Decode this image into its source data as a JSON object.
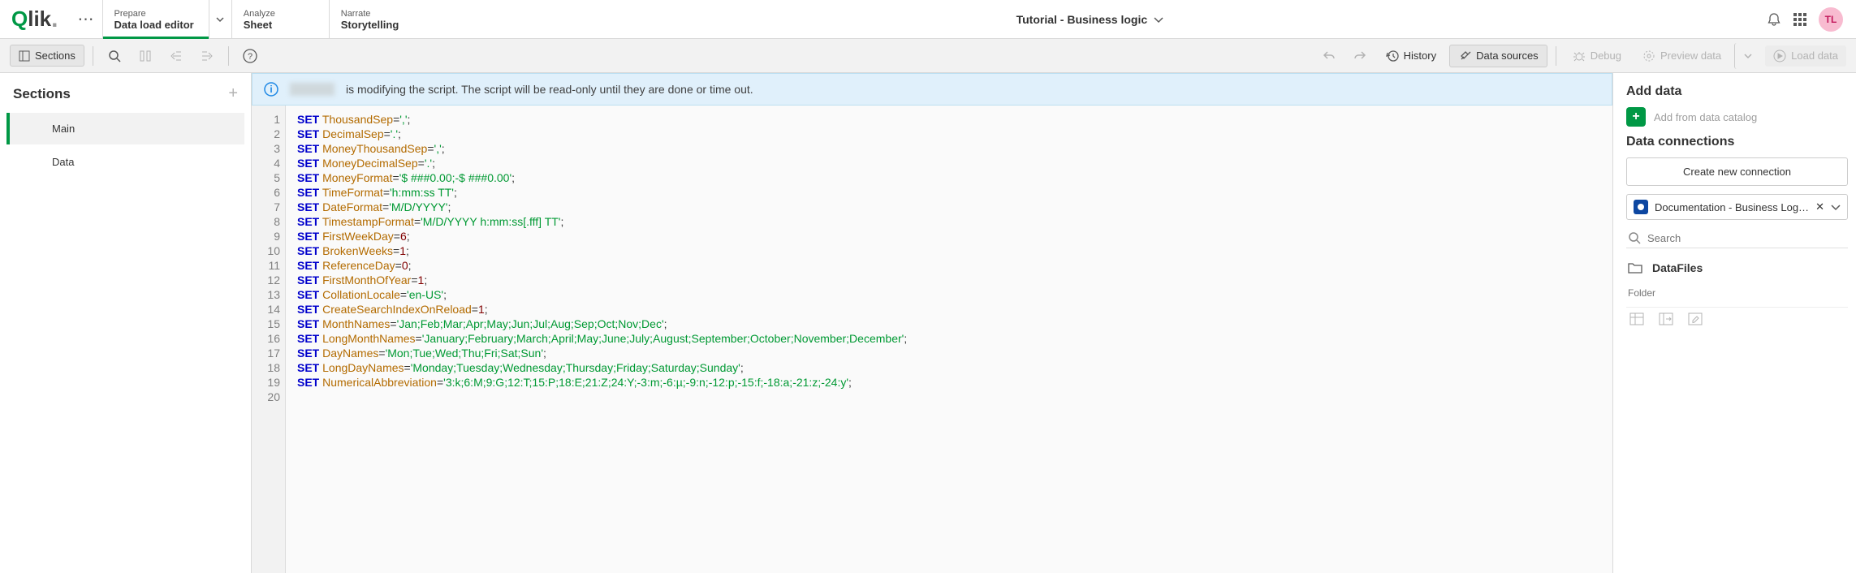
{
  "header": {
    "logo_text": "Qlik",
    "tabs": [
      {
        "small": "Prepare",
        "big": "Data load editor",
        "active": true,
        "has_chev": true
      },
      {
        "small": "Analyze",
        "big": "Sheet",
        "active": false,
        "has_chev": false
      },
      {
        "small": "Narrate",
        "big": "Storytelling",
        "active": false,
        "has_chev": false
      }
    ],
    "app_title": "Tutorial - Business logic",
    "avatar_initials": "TL"
  },
  "toolbar": {
    "sections_label": "Sections",
    "history_label": "History",
    "data_sources_label": "Data sources",
    "debug_label": "Debug",
    "preview_label": "Preview data",
    "load_label": "Load data"
  },
  "sidebar": {
    "title": "Sections",
    "items": [
      {
        "label": "Main",
        "active": true
      },
      {
        "label": "Data",
        "active": false
      }
    ]
  },
  "banner": {
    "text": "is modifying the script. The script will be read-only until they are done or time out."
  },
  "script_lines": [
    {
      "k": "SET",
      "i": "ThousandSep",
      "eq": "=",
      "v": "','",
      "t": ";"
    },
    {
      "k": "SET",
      "i": "DecimalSep",
      "eq": "=",
      "v": "'.'",
      "t": ";"
    },
    {
      "k": "SET",
      "i": "MoneyThousandSep",
      "eq": "=",
      "v": "','",
      "t": ";"
    },
    {
      "k": "SET",
      "i": "MoneyDecimalSep",
      "eq": "=",
      "v": "'.'",
      "t": ";"
    },
    {
      "k": "SET",
      "i": "MoneyFormat",
      "eq": "=",
      "v": "'$ ###0.00;-$ ###0.00'",
      "t": ";"
    },
    {
      "k": "SET",
      "i": "TimeFormat",
      "eq": "=",
      "v": "'h:mm:ss TT'",
      "t": ";"
    },
    {
      "k": "SET",
      "i": "DateFormat",
      "eq": "=",
      "v": "'M/D/YYYY'",
      "t": ";"
    },
    {
      "k": "SET",
      "i": "TimestampFormat",
      "eq": "=",
      "v": "'M/D/YYYY h:mm:ss[.fff] TT'",
      "t": ";"
    },
    {
      "k": "SET",
      "i": "FirstWeekDay",
      "eq": "=",
      "n": "6",
      "t": ";"
    },
    {
      "k": "SET",
      "i": "BrokenWeeks",
      "eq": "=",
      "n": "1",
      "t": ";"
    },
    {
      "k": "SET",
      "i": "ReferenceDay",
      "eq": "=",
      "n": "0",
      "t": ";"
    },
    {
      "k": "SET",
      "i": "FirstMonthOfYear",
      "eq": "=",
      "n": "1",
      "t": ";"
    },
    {
      "k": "SET",
      "i": "CollationLocale",
      "eq": "=",
      "v": "'en-US'",
      "t": ";"
    },
    {
      "k": "SET",
      "i": "CreateSearchIndexOnReload",
      "eq": "=",
      "n": "1",
      "t": ";"
    },
    {
      "k": "SET",
      "i": "MonthNames",
      "eq": "=",
      "v": "'Jan;Feb;Mar;Apr;May;Jun;Jul;Aug;Sep;Oct;Nov;Dec'",
      "t": ";"
    },
    {
      "k": "SET",
      "i": "LongMonthNames",
      "eq": "=",
      "v": "'January;February;March;April;May;June;July;August;September;October;November;December'",
      "t": ";"
    },
    {
      "k": "SET",
      "i": "DayNames",
      "eq": "=",
      "v": "'Mon;Tue;Wed;Thu;Fri;Sat;Sun'",
      "t": ";"
    },
    {
      "k": "SET",
      "i": "LongDayNames",
      "eq": "=",
      "v": "'Monday;Tuesday;Wednesday;Thursday;Friday;Saturday;Sunday'",
      "t": ";"
    },
    {
      "k": "SET",
      "i": "NumericalAbbreviation",
      "eq": "=",
      "v": "'3:k;6:M;9:G;12:T;15:P;18:E;21:Z;24:Y;-3:m;-6:µ;-9:n;-12:p;-15:f;-18:a;-21:z;-24:y'",
      "t": ";"
    }
  ],
  "right": {
    "add_data_title": "Add data",
    "add_catalog_label": "Add from data catalog",
    "connections_title": "Data connections",
    "create_conn_label": "Create new connection",
    "connection_name": "Documentation - Business Logic ...",
    "search_placeholder": "Search",
    "folder_name": "DataFiles",
    "folder_type": "Folder"
  }
}
